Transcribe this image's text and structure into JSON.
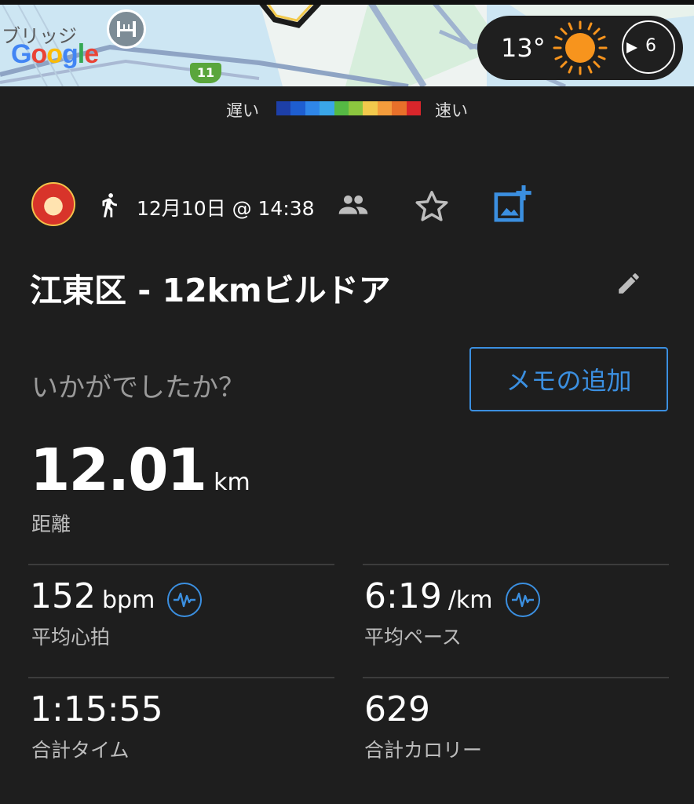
{
  "map": {
    "bridge_label": "ブリッジ",
    "google_letters": [
      "G",
      "o",
      "o",
      "g",
      "l",
      "e"
    ],
    "route_number": "11"
  },
  "weather": {
    "temperature": "13°",
    "icon": "sun-icon",
    "wind_speed": "6"
  },
  "pace_legend": {
    "slow_label": "遅い",
    "fast_label": "速い",
    "colors": [
      "#1d3fa8",
      "#1e5ed0",
      "#2f86e8",
      "#3aa6e8",
      "#55b944",
      "#8cc63f",
      "#f2c94c",
      "#f39c3c",
      "#e8702a",
      "#d9262b"
    ]
  },
  "activity": {
    "activity_icon": "running-icon",
    "date": "12月10日 @ 14:38",
    "title": "江東区 - 12kmビルドア",
    "question": "いかがでしたか？",
    "memo_button": "メモの追加"
  },
  "stats": {
    "distance": {
      "value": "12.01",
      "unit": "km",
      "label": "距離"
    },
    "heart_rate": {
      "value": "152",
      "unit": "bpm",
      "label": "平均心拍"
    },
    "pace": {
      "value": "6:19",
      "unit": "/km",
      "label": "平均ペース"
    },
    "time": {
      "value": "1:15:55",
      "label": "合計タイム"
    },
    "calories": {
      "value": "629",
      "label": "合計カロリー"
    }
  },
  "colors": {
    "background": "#1e1e1e",
    "accent": "#3b8fe0",
    "secondary_text": "#bdbdbd"
  }
}
